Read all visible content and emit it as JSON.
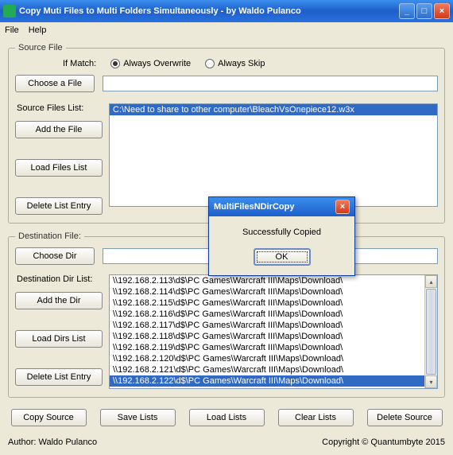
{
  "window": {
    "title": "Copy Muti Files to Multi Folders Simultaneously - by Waldo Pulanco"
  },
  "menu": {
    "file": "File",
    "help": "Help"
  },
  "source": {
    "legend": "Source File",
    "if_match": "If Match:",
    "always_overwrite": "Always Overwrite",
    "always_skip": "Always Skip",
    "choose_file": "Choose a File",
    "file_value": "",
    "list_label": "Source Files List:",
    "add_file": "Add the File",
    "load_list": "Load Files List",
    "delete_entry": "Delete List Entry",
    "items": [
      "C:\\Need to share to other computer\\BleachVsOnepiece12.w3x"
    ]
  },
  "dest": {
    "legend": "Destination File:",
    "choose_dir": "Choose Dir",
    "dir_value": "",
    "list_label": "Destination Dir List:",
    "add_dir": "Add the Dir",
    "load_list": "Load Dirs List",
    "delete_entry": "Delete List Entry",
    "items": [
      "\\\\192.168.2.113\\d$\\PC Games\\Warcraft III\\Maps\\Download\\",
      "\\\\192.168.2.114\\d$\\PC Games\\Warcraft III\\Maps\\Download\\",
      "\\\\192.168.2.115\\d$\\PC Games\\Warcraft III\\Maps\\Download\\",
      "\\\\192.168.2.116\\d$\\PC Games\\Warcraft III\\Maps\\Download\\",
      "\\\\192.168.2.117\\d$\\PC Games\\Warcraft III\\Maps\\Download\\",
      "\\\\192.168.2.118\\d$\\PC Games\\Warcraft III\\Maps\\Download\\",
      "\\\\192.168.2.119\\d$\\PC Games\\Warcraft III\\Maps\\Download\\",
      "\\\\192.168.2.120\\d$\\PC Games\\Warcraft III\\Maps\\Download\\",
      "\\\\192.168.2.121\\d$\\PC Games\\Warcraft III\\Maps\\Download\\",
      "\\\\192.168.2.122\\d$\\PC Games\\Warcraft III\\Maps\\Download\\"
    ]
  },
  "bottom": {
    "copy": "Copy Source",
    "save": "Save Lists",
    "load": "Load Lists",
    "clear": "Clear Lists",
    "delete": "Delete Source"
  },
  "footer": {
    "author": "Author: Waldo Pulanco",
    "copyright": "Copyright © Quantumbyte 2015"
  },
  "dialog": {
    "title": "MultiFilesNDirCopy",
    "message": "Successfully Copied",
    "ok": "OK"
  }
}
